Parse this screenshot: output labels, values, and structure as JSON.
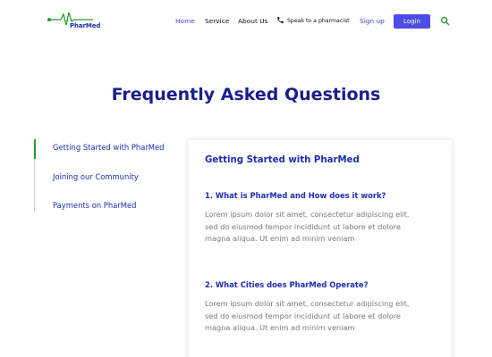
{
  "header": {
    "logo_text": "PharMed",
    "nav": {
      "home": "Home",
      "service": "Service",
      "about": "About Us",
      "speak": "Speak to a pharmacist",
      "signup": "Sign up",
      "login": "Login"
    }
  },
  "main": {
    "title": "Frequently Asked Questions",
    "tabs": [
      {
        "label": "Getting Started with PharMed",
        "active": true
      },
      {
        "label": "Joining our Community",
        "active": false
      },
      {
        "label": "Payments on PharMed",
        "active": false
      }
    ],
    "card": {
      "heading": "Getting Started with PharMed",
      "faqs": [
        {
          "question": "1. What is PharMed and How does it work?",
          "answer": "Lorem ipsum dolor sit amet, consectetur adipiscing elit, sed do eiusmod tempor incididunt ut labore et dolore magna aliqua. Ut enim ad minim veniam"
        },
        {
          "question": "2. What Cities does PharMed Operate?",
          "answer": "Lorem ipsum dolor sit amet, consectetur adipiscing elit, sed do eiusmod tempor incididunt ut labore et dolore magna aliqua. Ut enim ad minim veniam"
        }
      ]
    }
  },
  "colors": {
    "brand_blue": "#1f2db3",
    "title_blue": "#1a1f8c",
    "login_button": "#4d4de6",
    "accent_green": "#2a9d2a",
    "body_gray": "#7a7a7a"
  },
  "icons": {
    "logo": "heartbeat-line-icon",
    "phone": "phone-icon",
    "search": "search-icon"
  }
}
